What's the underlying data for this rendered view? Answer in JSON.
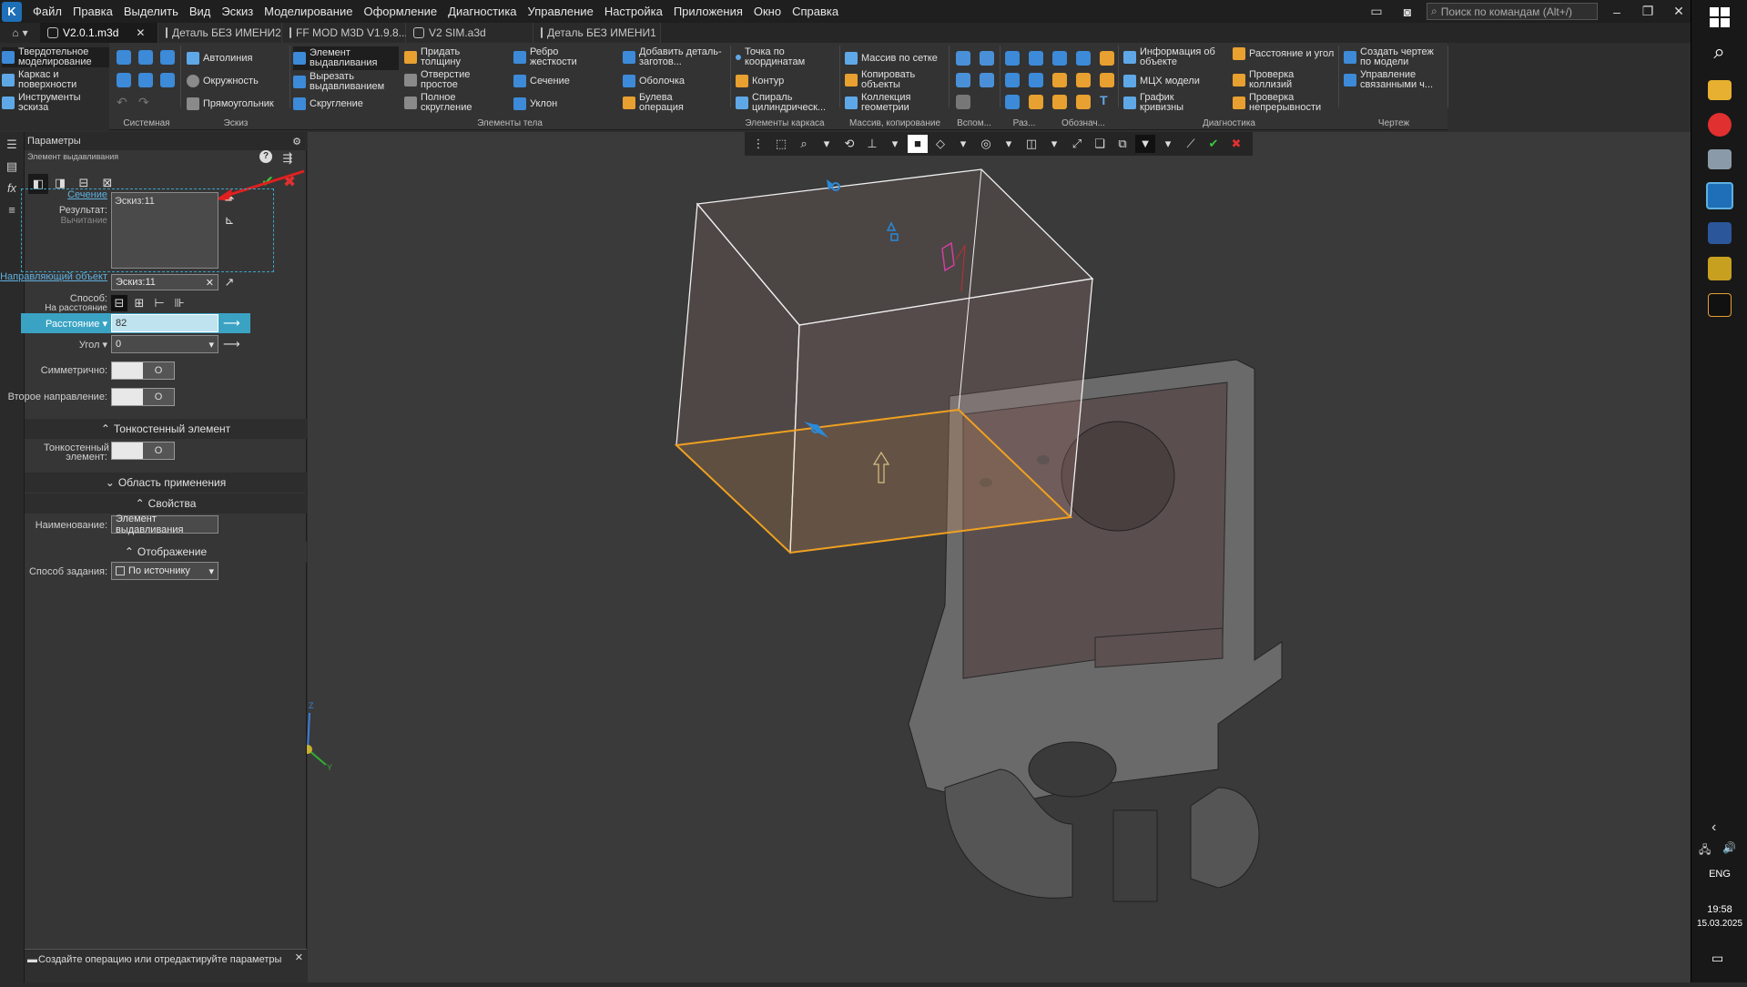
{
  "menu": {
    "items": [
      "Файл",
      "Правка",
      "Выделить",
      "Вид",
      "Эскиз",
      "Моделирование",
      "Оформление",
      "Диагностика",
      "Управление",
      "Настройка",
      "Приложения",
      "Окно",
      "Справка"
    ],
    "search_placeholder": "Поиск по командам (Alt+/)"
  },
  "tabs": [
    {
      "label": "V2.0.1.m3d",
      "active": true
    },
    {
      "label": "Деталь БЕЗ ИМЕНИ2",
      "active": false
    },
    {
      "label": "FF MOD M3D V1.9.8....",
      "active": false
    },
    {
      "label": "V2 SIM.a3d",
      "active": false
    },
    {
      "label": "Деталь БЕЗ ИМЕНИ1",
      "active": false
    }
  ],
  "ribbon": {
    "modes": [
      "Твердотельное моделирование",
      "Каркас и поверхности",
      "Инструменты эскиза"
    ],
    "sketch": [
      "Автолиния",
      "Окружность",
      "Прямоугольник"
    ],
    "body": [
      "Элемент выдавливания",
      "Вырезать выдавливанием",
      "Скругление",
      "Придать толщину",
      "Отверстие простое",
      "Полное скругление",
      "Ребро жесткости",
      "Сечение",
      "Уклон",
      "Добавить деталь-заготов...",
      "Оболочка",
      "Булева операция"
    ],
    "frame": [
      "Точка по координатам",
      "Контур",
      "Спираль цилиндрическ..."
    ],
    "array": [
      "Массив по сетке",
      "Копировать объекты",
      "Коллекция геометрии"
    ],
    "diag": [
      "Информация об объекте",
      "МЦХ модели",
      "График кривизны",
      "Расстояние и угол",
      "Проверка коллизий",
      "Проверка непрерывности"
    ],
    "drawing": [
      "Создать чертеж по модели",
      "Управление связанными ч..."
    ],
    "groups": [
      "Системная",
      "Эскиз",
      "Элементы тела",
      "Элементы каркаса",
      "Массив, копирование",
      "Вспом...",
      "Раз...",
      "Обознач...",
      "Диагностика",
      "Чертеж"
    ]
  },
  "panel": {
    "header": "Параметры",
    "subtitle": "Элемент выдавливания",
    "result_label": "Результат:",
    "result_value": "Вычитание",
    "section_link": "Сечение",
    "section_value": "Эскиз:11",
    "direction_link": "Направляющий объект",
    "direction_value": "Эскиз:11",
    "method_label": "Способ:",
    "method_value": "На расстояние",
    "distance_label": "Расстояние",
    "distance_value": "82",
    "angle_label": "Угол",
    "angle_value": "0",
    "symmetric_label": "Симметрично:",
    "second_dir_label": "Второе направление:",
    "thin_section": "Тонкостенный элемент",
    "thin_label": "Тонкостенный элемент:",
    "apply_section": "Область применения",
    "props_section": "Свойства",
    "name_label": "Наименование:",
    "name_value": "Элемент выдавливания",
    "display_section": "Отображение",
    "mode_label": "Способ задания:",
    "mode_value": "По источнику",
    "hint": "Создайте операцию или отредактируйте параметры"
  },
  "axes": {
    "x": "X",
    "y": "Y",
    "z": "Z"
  },
  "taskbar": {
    "lang": "ENG",
    "time": "19:58",
    "date": "15.03.2025"
  },
  "colors": {
    "accent": "#3aa3c4",
    "selection": "#f0a020",
    "ok": "#3cc83c",
    "cancel": "#e03030"
  }
}
